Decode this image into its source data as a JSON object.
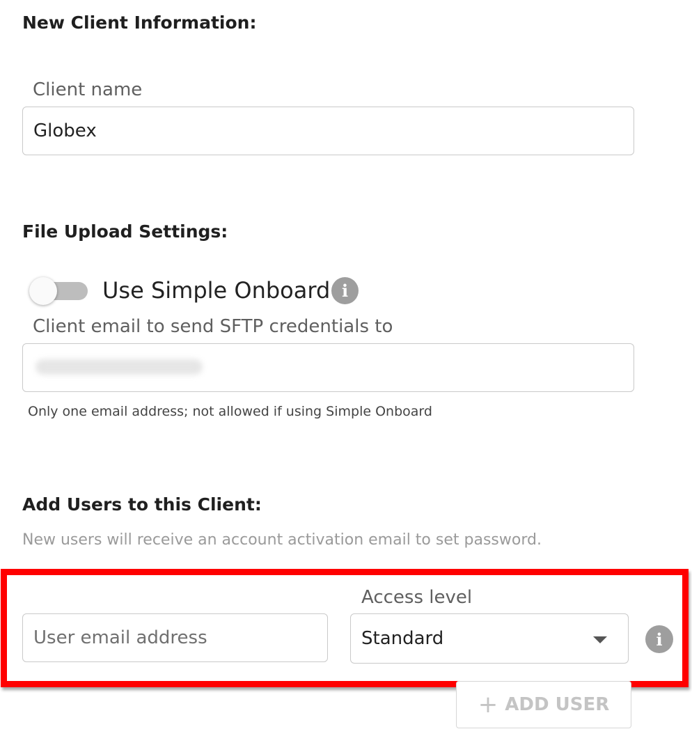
{
  "client_info": {
    "heading": "New Client Information:",
    "name_label": "Client name",
    "name_value": "Globex"
  },
  "file_upload": {
    "heading": "File Upload Settings:",
    "simple_onboard_label": "Use Simple Onboard",
    "simple_onboard_enabled": false,
    "sftp_email_label": "Client email to send SFTP credentials to",
    "sftp_email_helper": "Only one email address; not allowed if using Simple Onboard",
    "info_icon": "info-icon"
  },
  "add_users": {
    "heading": "Add Users to this Client:",
    "hint": "New users will receive an account activation email to set password.",
    "email_placeholder": "User email address",
    "access_level_label": "Access level",
    "access_level_value": "Standard",
    "add_user_label": "ADD USER",
    "add_user_icon": "plus-icon",
    "info_icon": "info-icon"
  },
  "colors": {
    "highlight": "#ff0000",
    "icon_gray": "#9e9e9e",
    "disabled_text": "#c4c4c4"
  }
}
